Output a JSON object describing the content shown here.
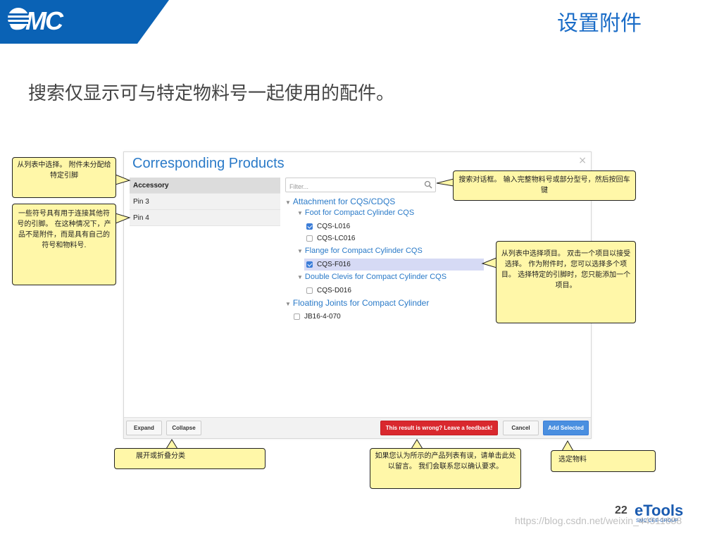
{
  "header": {
    "logo_text": "SMC",
    "slide_title": "设置附件",
    "subtitle": "搜索仅显示可与特定物料号一起使用的配件。",
    "brand_color": "#0a62b5"
  },
  "dialog": {
    "title": "Corresponding Products",
    "close": "×",
    "left_list": [
      "Accessory",
      "Pin 3",
      "Pin 4"
    ],
    "filter_placeholder": "Filter...",
    "tree": {
      "cat1": "Attachment for CQS/CDQS",
      "sub1": "Foot for Compact Cylinder CQS",
      "sub1_items": [
        "CQS-L016",
        "CQS-LC016"
      ],
      "sub2": "Flange for Compact Cylinder CQS",
      "sub2_items": [
        "CQS-F016"
      ],
      "sub3": "Double Clevis for Compact Cylinder CQS",
      "sub3_items": [
        "CQS-D016"
      ],
      "cat2": "Floating Joints for Compact Cylinder",
      "cat2_items": [
        "JB16-4-070"
      ]
    },
    "buttons": {
      "expand": "Expand",
      "collapse": "Collapse",
      "feedback": "This result is wrong? Leave a feedback!",
      "cancel": "Cancel",
      "add": "Add Selected"
    }
  },
  "callouts": {
    "c1": "从列表中选择。 附件未分配给特定引脚",
    "c2": "一些符号具有用于连接其他符号的引脚。 在这种情况下，产品不是附件，而是具有自己的符号和物料号.",
    "c3": "搜索对话框。 输入完整物料号或部分型号，然后按回车键",
    "c4": "从列表中选择项目。 双击一个项目以接受选择。 作为附件时，您可以选择多个项目。 选择特定的引脚时，您只能添加一个项目。",
    "c5": "展开或折叠分类",
    "c6": "如果您认为所示的产品列表有误，请单击此处以留言。 我们会联系您以确认要求。",
    "c7": "选定物料"
  },
  "footer": {
    "page": "22",
    "brand": "eTools",
    "brand_sub": "SMC CEE-GROUP",
    "watermark": "https://blog.csdn.net/weixin_44511688"
  }
}
